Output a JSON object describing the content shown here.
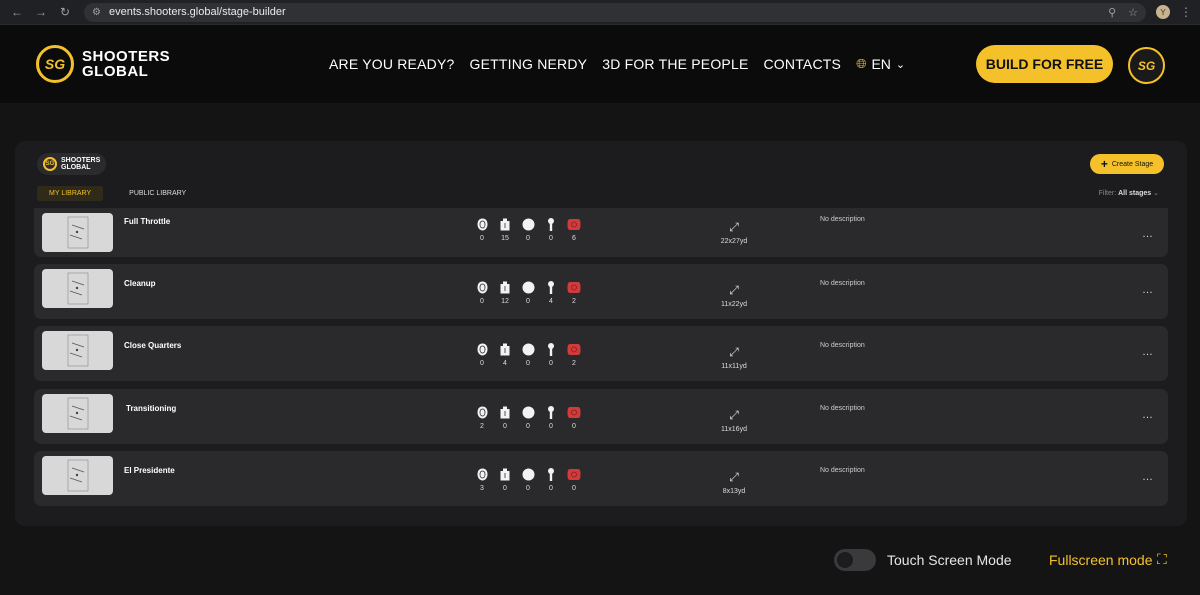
{
  "browser": {
    "url": "events.shooters.global/stage-builder",
    "profile_initial": "Y"
  },
  "header": {
    "logo_line1": "SHOOTERS",
    "logo_line2": "GLOBAL",
    "logo_mark": "SG",
    "nav": [
      "ARE YOU READY?",
      "GETTING NERDY",
      "3D FOR THE PEOPLE",
      "CONTACTS"
    ],
    "language": "EN",
    "cta": "BUILD FOR FREE",
    "accent_color": "#f5c12a"
  },
  "panel": {
    "logo_line1": "SHOOTERS",
    "logo_line2": "GLOBAL",
    "create_label": "Create Stage",
    "tabs": [
      "MY LIBRARY",
      "PUBLIC LIBRARY"
    ],
    "active_tab": "MY LIBRARY",
    "filter_label": "Filter:",
    "filter_value": "All stages",
    "stages": [
      {
        "name": "Full Throttle",
        "counts": [
          "0",
          "15",
          "0",
          "0",
          "6"
        ],
        "dims": "22x27yd",
        "description": "No description"
      },
      {
        "name": "Cleanup",
        "counts": [
          "0",
          "12",
          "0",
          "4",
          "2"
        ],
        "dims": "11x22yd",
        "description": "No description"
      },
      {
        "name": "Close Quarters",
        "counts": [
          "0",
          "4",
          "0",
          "0",
          "2"
        ],
        "dims": "11x11yd",
        "description": "No description"
      },
      {
        "name": "Transitioning",
        "counts": [
          "2",
          "0",
          "0",
          "0",
          "0"
        ],
        "dims": "11x16yd",
        "description": "No description"
      },
      {
        "name": "El Presidente",
        "counts": [
          "3",
          "0",
          "0",
          "0",
          "0"
        ],
        "dims": "8x13yd",
        "description": "No description"
      }
    ]
  },
  "footer": {
    "touch_label": "Touch Screen Mode",
    "fullscreen_label": "Fullscreen mode"
  }
}
